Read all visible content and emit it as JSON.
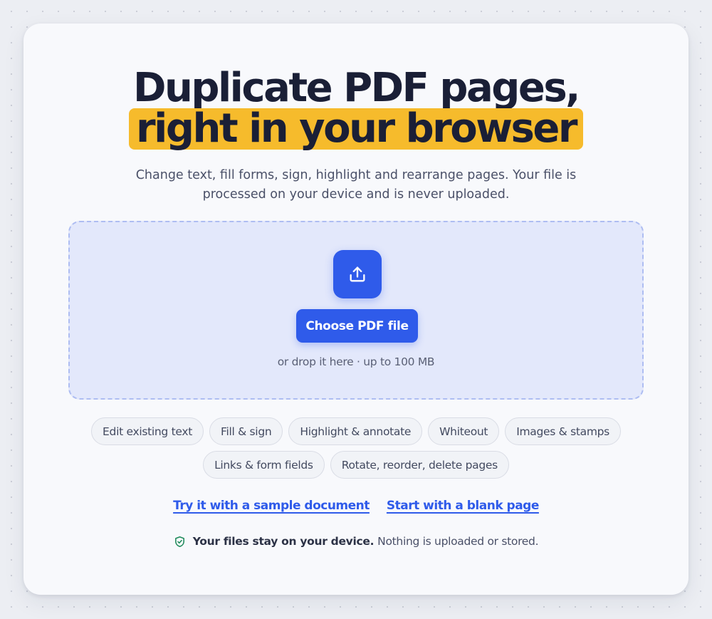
{
  "hero": {
    "title_line1": "Duplicate PDF pages,",
    "title_line2": "right in your browser",
    "subtitle": "Change text, fill forms, sign, highlight and rearrange pages. Your file is processed on your device and is never uploaded."
  },
  "dropzone": {
    "icon": "upload-icon",
    "button_label": "Choose PDF file",
    "hint": "or drop it here · up to 100 MB"
  },
  "features": [
    "Edit existing text",
    "Fill & sign",
    "Highlight & annotate",
    "Whiteout",
    "Images & stamps",
    "Links & form fields",
    "Rotate, reorder, delete pages"
  ],
  "links": {
    "sample": "Try it with a sample document",
    "blank": "Start with a blank page"
  },
  "privacy": {
    "icon": "shield-check-icon",
    "bold": "Your files stay on your device.",
    "text": "Nothing is uploaded or stored."
  },
  "colors": {
    "accent": "#2f5bea",
    "highlight": "#f6bb2c",
    "shield": "#1f8a5b"
  }
}
